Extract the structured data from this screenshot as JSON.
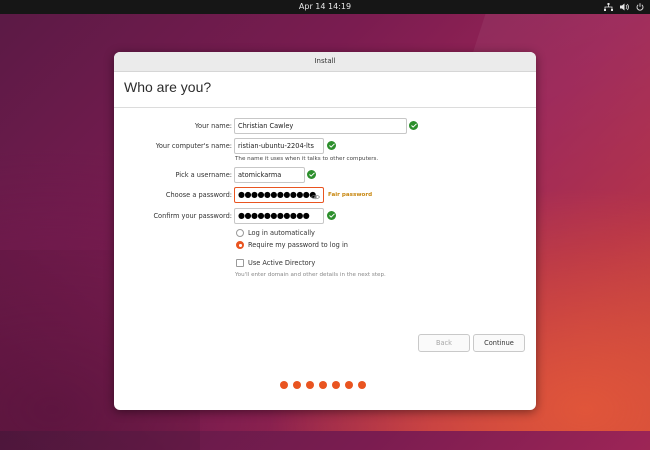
{
  "topbar": {
    "clock": "Apr 14  14:19",
    "icons": [
      "network-icon",
      "volume-icon",
      "power-icon"
    ]
  },
  "window": {
    "title": "Install",
    "heading": "Who are you?"
  },
  "form": {
    "name": {
      "label": "Your name:",
      "value": "Christian Cawley"
    },
    "computer": {
      "label": "Your computer's name:",
      "value": "ristian-ubuntu-2204-lts",
      "hint": "The name it uses when it talks to other computers."
    },
    "username": {
      "label": "Pick a username:",
      "value": "atomickarma"
    },
    "password": {
      "label": "Choose a password:",
      "value": "●●●●●●●●●●●●",
      "strength": "Fair password"
    },
    "confirm": {
      "label": "Confirm your password:",
      "value": "●●●●●●●●●●●"
    },
    "login_auto": "Log in automatically",
    "login_require": "Require my password to log in",
    "login_selected": "Require my password to log in",
    "active_directory": "Use Active Directory",
    "active_directory_checked": false,
    "ad_hint": "You'll enter domain and other details in the next step."
  },
  "buttons": {
    "back": "Back",
    "continue": "Continue"
  },
  "progress": {
    "total_steps": 7
  },
  "colors": {
    "accent": "#e95420",
    "success": "#2c8f2c",
    "warning": "#c7860e"
  }
}
